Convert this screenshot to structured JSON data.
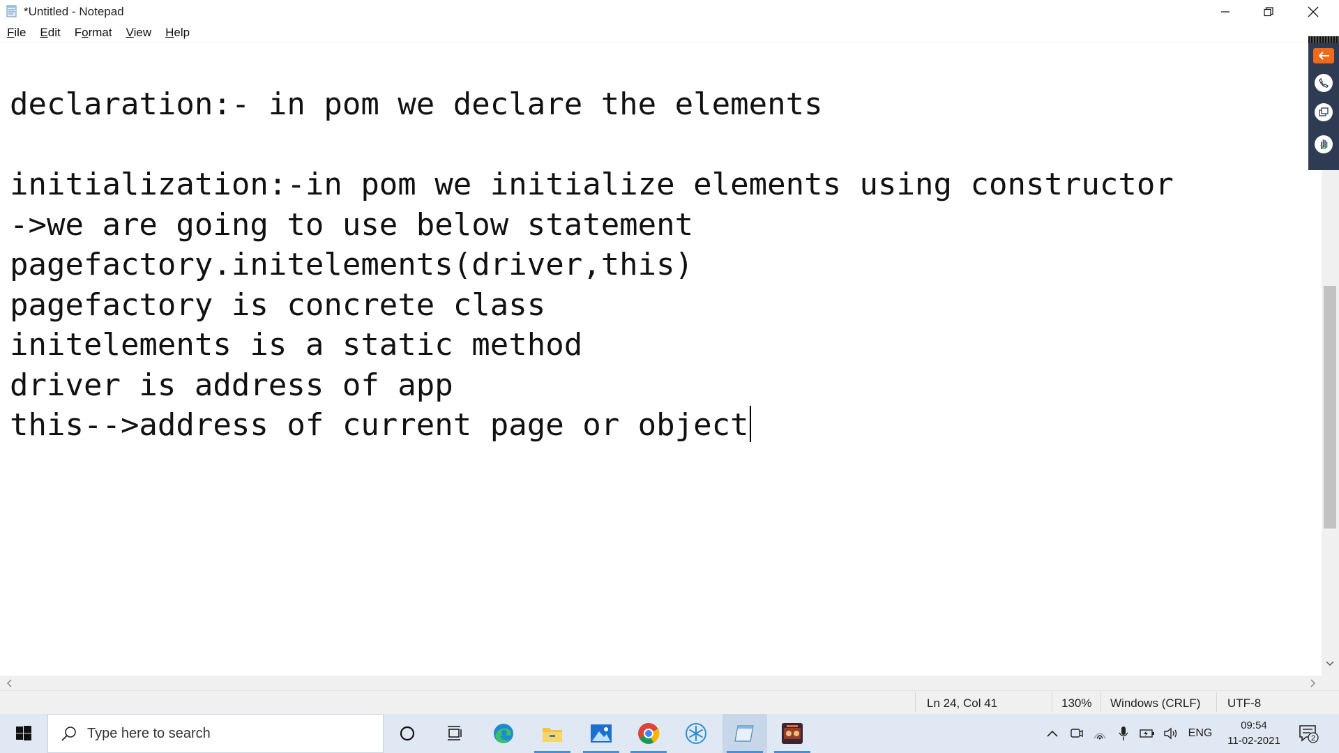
{
  "window": {
    "title": "*Untitled - Notepad",
    "controls": [
      "minimize",
      "restore",
      "close"
    ]
  },
  "menu": [
    {
      "label": "File",
      "u": "F",
      "rest": "ile"
    },
    {
      "label": "Edit",
      "u": "E",
      "rest": "dit"
    },
    {
      "label": "Format",
      "u": "o",
      "pre": "F",
      "rest": "rmat"
    },
    {
      "label": "View",
      "u": "V",
      "rest": "iew"
    },
    {
      "label": "Help",
      "u": "H",
      "rest": "elp"
    }
  ],
  "editor": {
    "lines": [
      "declaration:- in pom we declare the elements",
      "",
      "initialization:-in pom we initialize elements using constructor",
      "->we are going to use below statement",
      "pagefactory.initelements(driver,this)",
      "pagefactory is concrete class",
      "initelements is a static method",
      "driver is address of app",
      "this-->address of current page or object"
    ]
  },
  "status": {
    "position": "Ln 24, Col 41",
    "zoom": "130%",
    "line_ending": "Windows (CRLF)",
    "encoding": "UTF-8"
  },
  "taskbar": {
    "search_placeholder": "Type here to search",
    "apps": [
      "cortana-icon",
      "task-view-icon",
      "edge-icon",
      "file-explorer-icon",
      "photos-icon",
      "chrome-icon",
      "snowflake-app-icon",
      "notepad-icon",
      "game-app-icon"
    ],
    "tray": {
      "language": "ENG",
      "time": "09:54",
      "date": "11-02-2021",
      "notifications": "2"
    }
  },
  "colors": {
    "accent_orange": "#f06a1a",
    "floatbar": "#2f3b52",
    "taskbar": "#dfe8f3"
  }
}
